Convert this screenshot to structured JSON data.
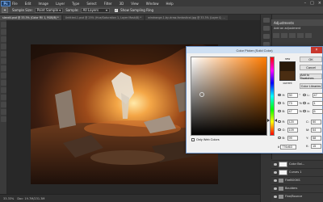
{
  "app": {
    "logo_text": "Ps"
  },
  "menu": [
    "File",
    "Edit",
    "Image",
    "Layer",
    "Type",
    "Select",
    "Filter",
    "3D",
    "View",
    "Window",
    "Help"
  ],
  "window_controls": [
    "–",
    "□",
    "×"
  ],
  "options_bar": {
    "tool_icon": "eyedropper-icon",
    "sample_size_label": "Sample Size:",
    "sample_size_value": "Point Sample",
    "sample_label": "Sample:",
    "sample_value": "All Layers",
    "show_ring_label": "Show Sampling Ring"
  },
  "doc_tabs": [
    {
      "label": "sland4.psd @ 33.3% (Color Fill 1, RGB/8) *",
      "active": true
    },
    {
      "label": "Untitled-1.psd @ 25% (Hue/Saturation 1, Layer Mask/8) *",
      "active": false
    },
    {
      "label": "windrange-1-by-draw-fantastical.jpg @ 33.3% (Layer 0, ...",
      "active": false
    }
  ],
  "status": {
    "zoom": "33.33%",
    "doc": "Doc: 19.7M/231.3M"
  },
  "adjustments": {
    "title": "Adjustments",
    "subtitle": "Add an adjustment"
  },
  "layers": [
    {
      "name": "Color Bal...",
      "thumb": "white",
      "kind": "adjustment"
    },
    {
      "name": "Curves 1",
      "thumb": "white",
      "kind": "adjustment"
    },
    {
      "name": "FireBOOKS",
      "kind": "folder"
    },
    {
      "name": "Boulders",
      "kind": "folder"
    },
    {
      "name": "Fine/Bounce",
      "kind": "folder"
    }
  ],
  "color_picker": {
    "title": "Color Picker (Solid Color)",
    "close": "×",
    "new_label": "new",
    "current_label": "current",
    "new_color": "#2a1a0a",
    "current_color": "#4a2d12",
    "ok": "OK",
    "cancel": "Cancel",
    "add_to_swatches": "Add to Swatches",
    "color_libraries": "Color Libraries",
    "only_web_colors": "Only Web Colors",
    "fields_left": [
      {
        "label": "H:",
        "value": "30",
        "unit": "°",
        "selected": true
      },
      {
        "label": "S:",
        "value": "73",
        "unit": "%",
        "selected": false
      },
      {
        "label": "B:",
        "value": "47",
        "unit": "%",
        "selected": false
      },
      {
        "label": "R:",
        "value": "120",
        "unit": "",
        "selected": false
      },
      {
        "label": "G:",
        "value": "109",
        "unit": "",
        "selected": false
      },
      {
        "label": "B:",
        "value": "99",
        "unit": "",
        "selected": false
      }
    ],
    "fields_right": [
      {
        "label": "L:",
        "value": "47"
      },
      {
        "label": "a:",
        "value": "1"
      },
      {
        "label": "b:",
        "value": "6"
      },
      {
        "label": "C:",
        "value": "50",
        "unit": "%"
      },
      {
        "label": "M:",
        "value": "54",
        "unit": "%"
      },
      {
        "label": "Y:",
        "value": "58",
        "unit": "%"
      },
      {
        "label": "K:",
        "value": "15",
        "unit": "%"
      }
    ],
    "hex_label": "#",
    "hex_value": "776d63"
  }
}
